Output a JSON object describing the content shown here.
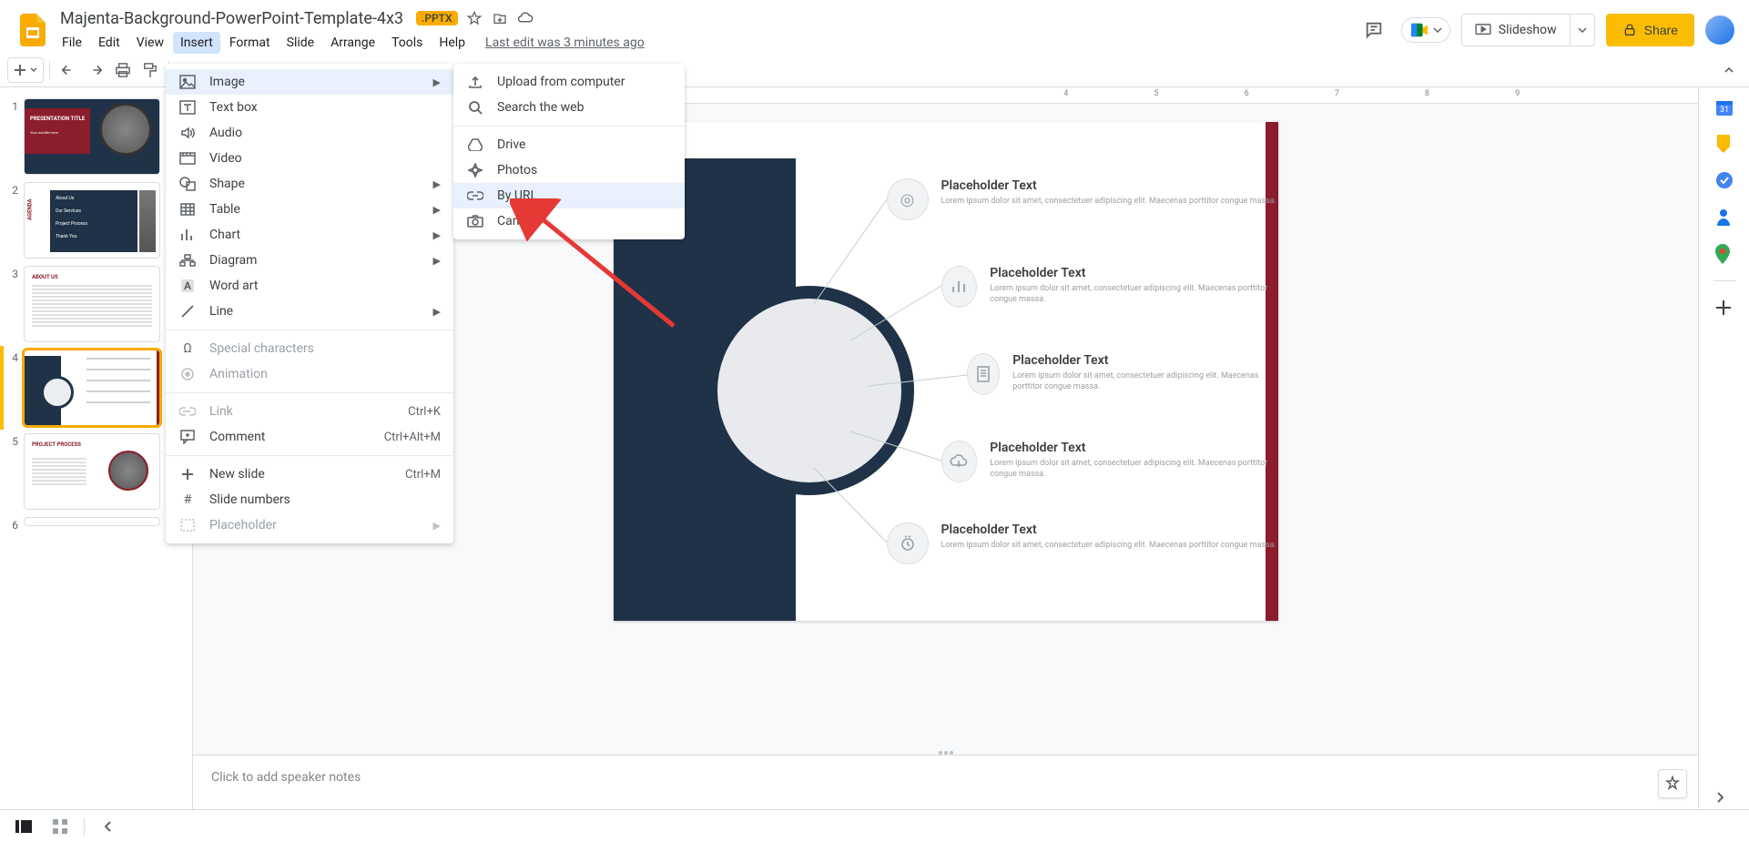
{
  "doc": {
    "title": "Majenta-Background-PowerPoint-Template-4x3",
    "badge": ".PPTX",
    "last_edit": "Last edit was 3 minutes ago"
  },
  "menubar": {
    "file": "File",
    "edit": "Edit",
    "view": "View",
    "insert": "Insert",
    "format": "Format",
    "slide": "Slide",
    "arrange": "Arrange",
    "tools": "Tools",
    "help": "Help"
  },
  "header": {
    "slideshow": "Slideshow",
    "share": "Share"
  },
  "insert_menu": {
    "image": "Image",
    "textbox": "Text box",
    "audio": "Audio",
    "video": "Video",
    "shape": "Shape",
    "table": "Table",
    "chart": "Chart",
    "diagram": "Diagram",
    "wordart": "Word art",
    "line": "Line",
    "special": "Special characters",
    "animation": "Animation",
    "link": "Link",
    "link_sc": "Ctrl+K",
    "comment": "Comment",
    "comment_sc": "Ctrl+Alt+M",
    "newslide": "New slide",
    "newslide_sc": "Ctrl+M",
    "slidenums": "Slide numbers",
    "placeholder": "Placeholder"
  },
  "image_menu": {
    "upload": "Upload from computer",
    "search": "Search the web",
    "drive": "Drive",
    "photos": "Photos",
    "byurl": "By URL",
    "camera": "Camera"
  },
  "speaker": {
    "placeholder": "Click to add speaker notes"
  },
  "slide": {
    "items": [
      {
        "title": "Placeholder Text",
        "body": "Lorem ipsum dolor sit amet, consectetuer adipiscing elit. Maecenas porttitor congue massa."
      },
      {
        "title": "Placeholder Text",
        "body": "Lorem ipsum dolor sit amet, consectetuer adipiscing elit. Maecenas porttitor congue massa."
      },
      {
        "title": "Placeholder Text",
        "body": "Lorem ipsum dolor sit amet, consectetuer adipiscing elit. Maecenas porttitor congue massa."
      },
      {
        "title": "Placeholder Text",
        "body": "Lorem ipsum dolor sit amet, consectetuer adipiscing elit. Maecenas porttitor congue massa."
      },
      {
        "title": "Placeholder Text",
        "body": "Lorem ipsum dolor sit amet, consectetuer adipiscing elit. Maecenas porttitor congue massa."
      }
    ]
  },
  "thumbs": {
    "t1": {
      "title": "PRESENTATION TITLE",
      "sub": "Your subtitle here"
    },
    "t2": {
      "title": "AGENDA",
      "i1": "About Us",
      "i2": "Our Services",
      "i3": "Project Process",
      "i4": "Thank You"
    },
    "t3": {
      "title": "ABOUT US"
    },
    "t5": {
      "title": "PROJECT PROCESS"
    }
  },
  "ruler": {
    "marks": [
      "4",
      "5",
      "6",
      "7",
      "8",
      "9"
    ]
  }
}
